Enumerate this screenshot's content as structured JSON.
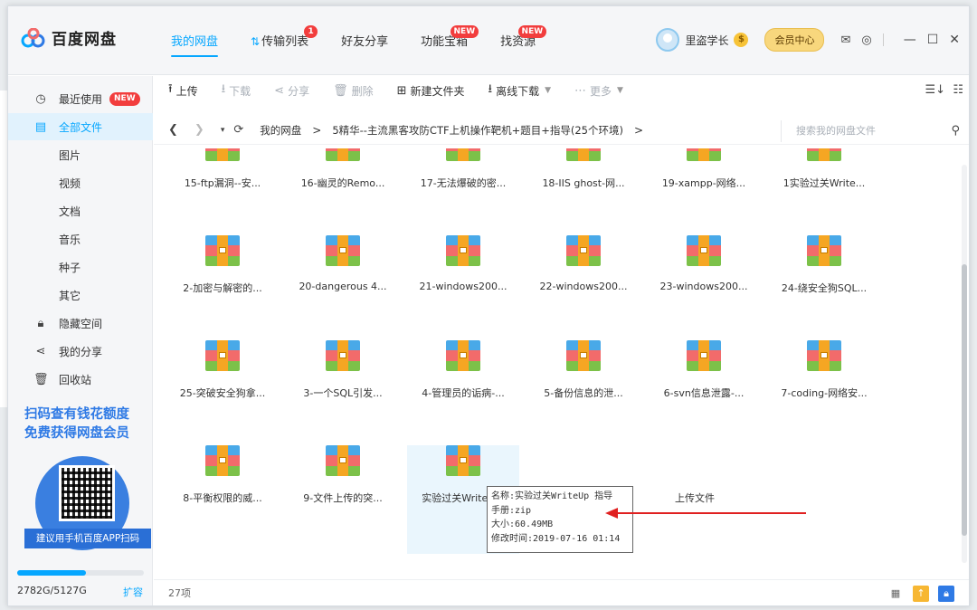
{
  "app": {
    "logo_text": "百度网盘",
    "nav": [
      {
        "label": "我的网盘",
        "badge": ""
      },
      {
        "label": "传输列表",
        "badge": "1"
      },
      {
        "label": "好友分享",
        "badge": ""
      },
      {
        "label": "功能宝箱",
        "badge": "NEW"
      },
      {
        "label": "找资源",
        "badge": "NEW"
      }
    ],
    "username": "里盗学长",
    "member_button": "会员中心"
  },
  "sidebar": {
    "items": [
      {
        "label": "最近使用",
        "icon": "clock-icon",
        "badge": "NEW"
      },
      {
        "label": "全部文件",
        "icon": "file-icon",
        "active": true
      },
      {
        "label": "图片"
      },
      {
        "label": "视频"
      },
      {
        "label": "文档"
      },
      {
        "label": "音乐"
      },
      {
        "label": "种子"
      },
      {
        "label": "其它"
      },
      {
        "label": "隐藏空间",
        "icon": "lock-icon"
      },
      {
        "label": "我的分享",
        "icon": "share-icon"
      },
      {
        "label": "回收站",
        "icon": "trash-icon"
      }
    ],
    "promo_line1": "扫码查有钱花额度",
    "promo_line2": "免费获得网盘会员",
    "qr_tip": "建议用手机百度APP扫码",
    "storage_used_fraction": 0.54,
    "storage_text": "2782G/5127G",
    "expand_label": "扩容"
  },
  "toolbar": {
    "upload": "上传",
    "download": "下载",
    "share": "分享",
    "delete": "删除",
    "new_folder": "新建文件夹",
    "offline_download": "离线下载",
    "more": "更多"
  },
  "path": {
    "root": "我的网盘",
    "sep": ">",
    "folder": "5精华--主流黑客攻防CTF上机操作靶机+题目+指导(25个环境)",
    "trail": ">",
    "search_placeholder": "搜索我的网盘文件"
  },
  "files": [
    "15-ftp漏洞--安...",
    "16-幽灵的Remo...",
    "17-无法爆破的密...",
    "18-IIS ghost-网...",
    "19-xampp-网络...",
    "1实验过关Write...",
    "2-加密与解密的...",
    "20-dangerous 4...",
    "21-windows200...",
    "22-windows200...",
    "23-windows200...",
    "24-绕安全狗SQL...",
    "25-突破安全狗拿...",
    "3-一个SQL引发...",
    "4-管理员的诟病-...",
    "5-备份信息的泄...",
    "6-svn信息泄露-...",
    "7-coding-网络安...",
    "8-平衡权限的威...",
    "9-文件上传的突...",
    "实验过关WriteU..."
  ],
  "upload_tile_label": "上传文件",
  "tooltip": {
    "name": "名称:实验过关WriteUp 指导",
    "type": "手册:zip",
    "size": "大小:60.49MB",
    "modified": "修改时间:2019-07-16 01:14"
  },
  "status": {
    "count": "27项"
  },
  "colors": {
    "accent": "#06a7ff",
    "badge_red": "#f23d3d",
    "promo_blue": "#2f7ae5",
    "annotation_arrow": "#e02020"
  }
}
